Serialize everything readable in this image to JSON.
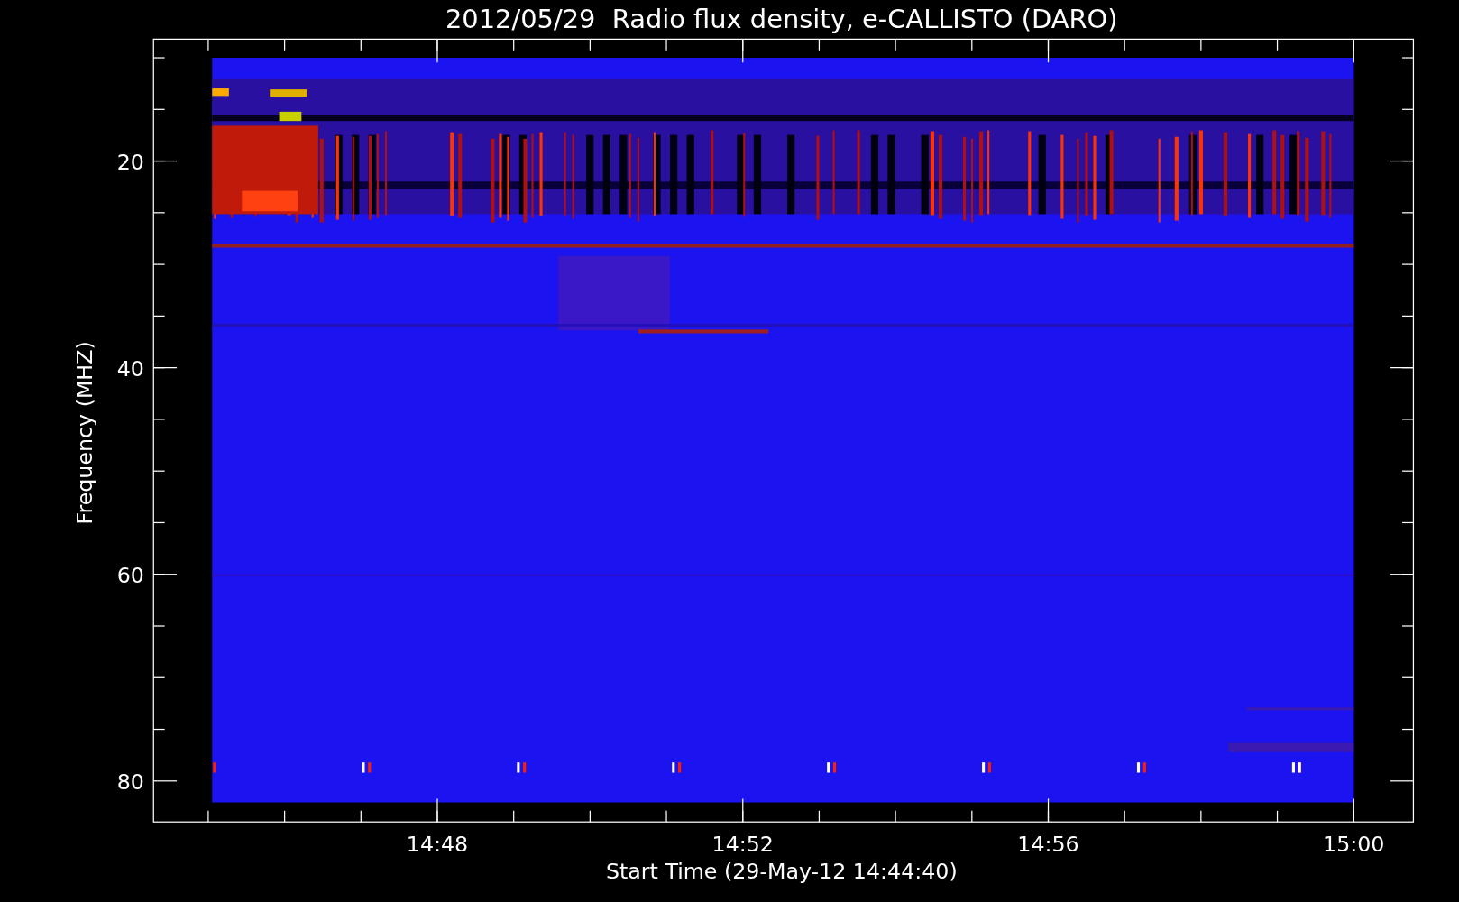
{
  "title": "2012/05/29  Radio flux density, e-CALLISTO (DARO)",
  "x_axis": {
    "label": "Start Time (29-May-12 14:44:40)",
    "ticks": [
      "14:48",
      "14:52",
      "14:56",
      "15:00"
    ]
  },
  "y_axis": {
    "label": "Frequency (MHZ)",
    "ticks": [
      "20",
      "40",
      "60",
      "80"
    ]
  }
}
